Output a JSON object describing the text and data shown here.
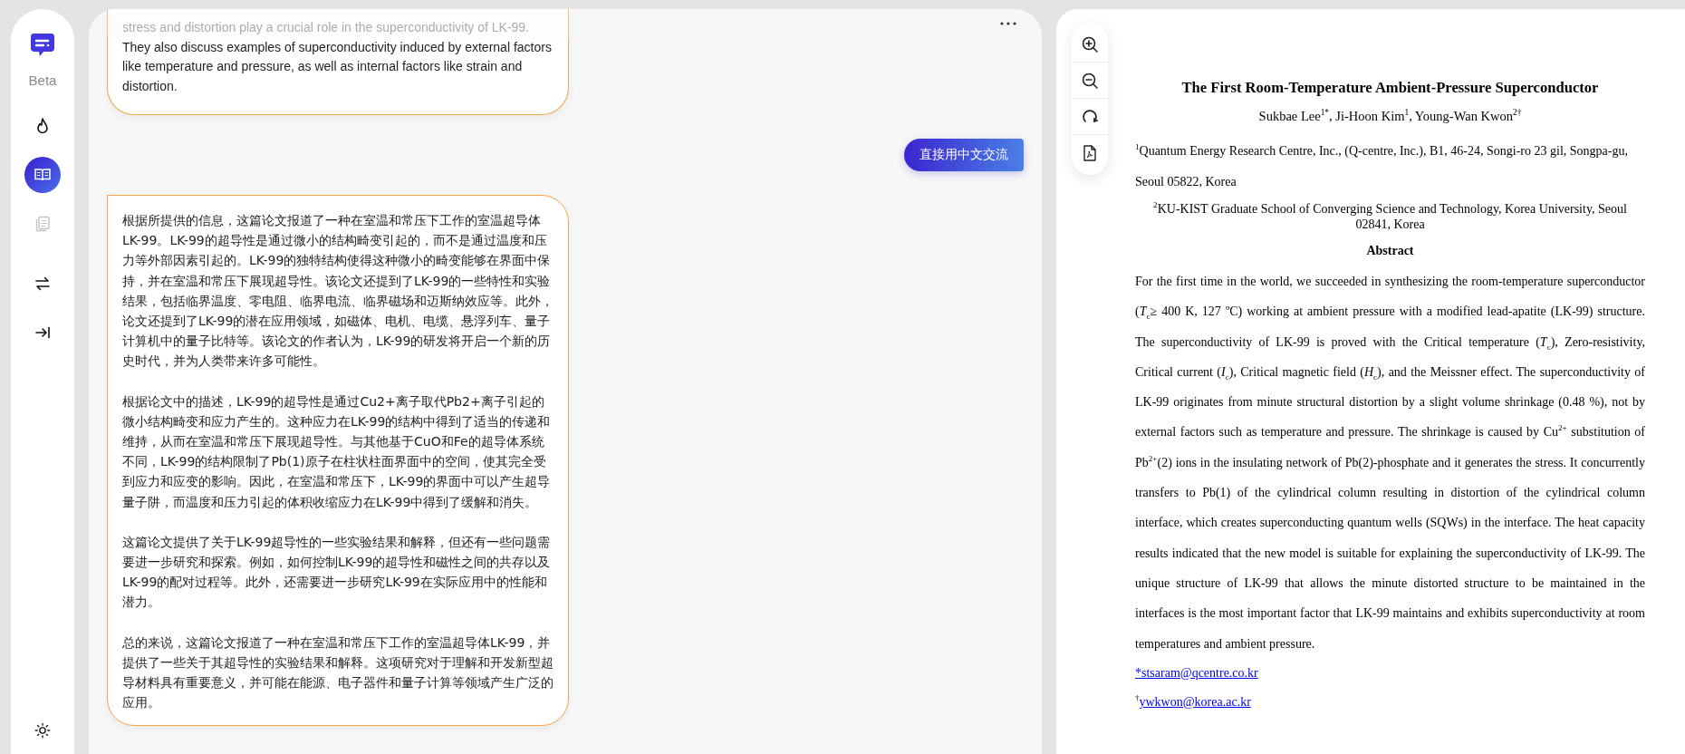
{
  "sidebar": {
    "badge": "Beta",
    "nav": [
      {
        "selected": false,
        "disabled": false
      },
      {
        "selected": true,
        "disabled": false
      },
      {
        "selected": false,
        "disabled": true
      },
      {
        "selected": false,
        "disabled": false
      },
      {
        "selected": false,
        "disabled": false
      }
    ]
  },
  "chat": {
    "messages": [
      {
        "kind": "assistant",
        "faded_line": "stress and distortion play a crucial role in the superconductivity of LK-99.",
        "paragraphs": [
          "They also discuss examples of superconductivity induced by external factors like temperature and pressure, as well as internal factors like strain and distortion."
        ]
      },
      {
        "kind": "user",
        "paragraphs": [
          "直接用中文交流"
        ]
      },
      {
        "kind": "assistant",
        "paragraphs": [
          "根据所提供的信息，这篇论文报道了一种在室温和常压下工作的室温超导体LK-99。LK-99的超导性是通过微小的结构畸变引起的，而不是通过温度和压力等外部因素引起的。LK-99的独特结构使得这种微小的畸变能够在界面中保持，并在室温和常压下展现超导性。该论文还提到了LK-99的一些特性和实验结果，包括临界温度、零电阻、临界电流、临界磁场和迈斯纳效应等。此外，论文还提到了LK-99的潜在应用领域，如磁体、电机、电缆、悬浮列车、量子计算机中的量子比特等。该论文的作者认为，LK-99的研发将开启一个新的历史时代，并为人类带来许多可能性。",
          "根据论文中的描述，LK-99的超导性是通过Cu2+离子取代Pb2+离子引起的微小结构畸变和应力产生的。这种应力在LK-99的结构中得到了适当的传递和维持，从而在室温和常压下展现超导性。与其他基于CuO和Fe的超导体系统不同，LK-99的结构限制了Pb(1)原子在柱状柱面界面中的空间，使其完全受到应力和应变的影响。因此，在室温和常压下，LK-99的界面中可以产生超导量子阱，而温度和压力引起的体积收缩应力在LK-99中得到了缓解和消失。",
          "这篇论文提供了关于LK-99超导性的一些实验结果和解释，但还有一些问题需要进一步研究和探索。例如，如何控制LK-99的超导性和磁性之间的共存以及LK-99的配对过程等。此外，还需要进一步研究LK-99在实际应用中的性能和潜力。",
          "总的来说，这篇论文报道了一种在室温和常压下工作的室温超导体LK-99，并提供了一些关于其超导性的实验结果和解释。这项研究对于理解和开发新型超导材料具有重要意义，并可能在能源、电子器件和量子计算等领域产生广泛的应用。"
        ]
      }
    ]
  },
  "document": {
    "title": "The First Room-Temperature Ambient-Pressure Superconductor",
    "authors": "Sukbae Lee$^{1*}$, Ji-Hoon Kim$^{1}$, Young-Wan Kwon$^{2†}$",
    "affiliations": [
      "$^{1}$Quantum Energy Research Centre, Inc., (Q-centre, Inc.), B1, 46-24, Songi-ro 23 gil, Songpa-gu, Seoul 05822, Korea",
      "$^{2}$KU-KIST Graduate School of Converging Science and Technology, Korea University, Seoul 02841, Korea"
    ],
    "abstract_heading": "Abstract",
    "abstract": "For the first time in the world, we succeeded in synthesizing the room-temperature superconductor (*T*$_{c}$≥ 400 K, 127 ºC) working at ambient pressure with a modified lead-apatite (LK-99) structure. The superconductivity of LK-99 is proved with the Critical temperature (*T*$_{c}$), Zero-resistivity, Critical current (*I*$_{c}$), Critical magnetic field (*H*$_{c}$), and the Meissner effect. The superconductivity of LK-99 originates from minute structural distortion by a slight volume shrinkage (0.48 %), not by external factors such as temperature and pressure. The shrinkage is caused by Cu$^{2+}$ substitution of Pb$^{2+}$(2) ions in the insulating network of Pb(2)-phosphate and it generates the stress. It concurrently transfers to Pb(1) of the cylindrical column resulting in distortion of the cylindrical column interface, which creates superconducting quantum wells (SQWs) in the interface. The heat capacity results indicated that the new model is suitable for explaining the superconductivity of LK-99. The unique structure of LK-99 that allows the minute distorted structure to be maintained in the interfaces is the most important factor that LK-99 maintains and exhibits superconductivity at room temperatures and ambient pressure.",
    "emails": [
      {
        "text": "*stsaram@qcentre.co.kr"
      },
      {
        "mark": "†",
        "text": "ywkwon@korea.ac.kr"
      }
    ]
  }
}
